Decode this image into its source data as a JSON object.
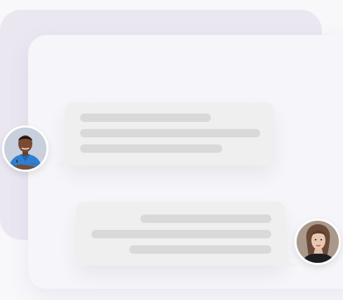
{
  "scene": {
    "colors": {
      "page_background": "#f8f7fa",
      "back_panel": "#ebe7f1",
      "front_panel": "#f6f5f9",
      "bubble": "#efefef",
      "placeholder_line": "#d9d9d9"
    }
  },
  "messages": [
    {
      "sender": "doctor-avatar",
      "placeholder_lines": 3
    },
    {
      "sender": "woman-avatar",
      "placeholder_lines": 3
    }
  ]
}
